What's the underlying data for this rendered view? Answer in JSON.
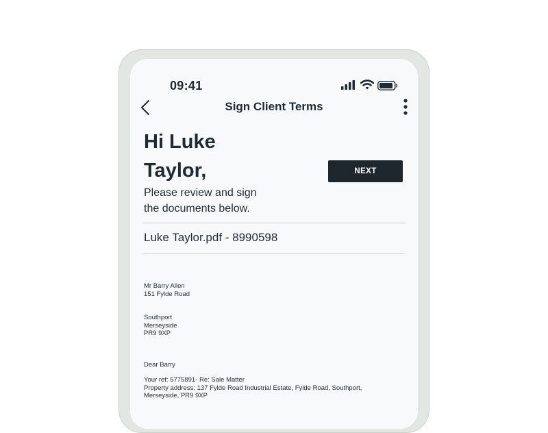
{
  "status_bar": {
    "time": "09:41",
    "icons": [
      "signal-icon",
      "wifi-icon",
      "battery-icon"
    ]
  },
  "nav": {
    "title": "Sign Client Terms",
    "back_icon": "chevron-left-icon",
    "more_icon": "more-vertical-icon"
  },
  "greeting": {
    "line1": "Hi Luke",
    "line2": "Taylor,"
  },
  "next_button": {
    "label": "NEXT"
  },
  "subtitle": {
    "line1": "Please review and sign",
    "line2": "the documents below."
  },
  "document": {
    "title": "Luke Taylor.pdf - 8990598"
  },
  "letter": {
    "recipient_name": "Mr Barry Allen",
    "address_line1": "151 Fylde Road",
    "town": "Southport",
    "county": "Merseyside",
    "postcode": "PR9 9XP",
    "salutation": "Dear Barry",
    "reference": "Your ref: 5775891- Re: Sale Matter",
    "property_address_line1": "Property address: 137 Fylde Road Industrial Estate, Fylde Road, Southport,",
    "property_address_line2": "Merseyside, PR9 9XP"
  },
  "colors": {
    "frame": "#e2e7e4",
    "screen": "#f8f9fb",
    "text": "#1f2a33",
    "button_bg": "#1f272e",
    "button_text": "#ffffff",
    "divider": "#c7cccf"
  }
}
